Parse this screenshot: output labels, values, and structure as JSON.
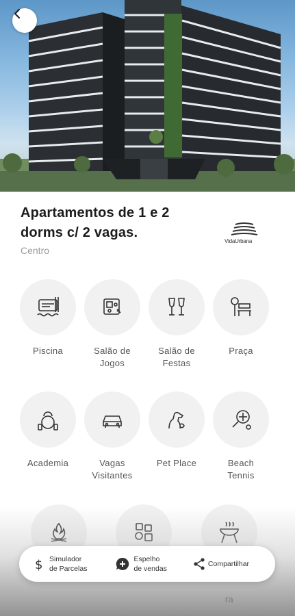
{
  "header": {
    "back_icon": "chevron-left-icon"
  },
  "property": {
    "title_line1": "Apartamentos de 1 e 2",
    "title_line2": "dorms c/ 2 vagas.",
    "location": "Centro",
    "brand_logo_text": "VidaUrbana"
  },
  "amenities": [
    {
      "label1": "Piscina",
      "label2": "",
      "icon": "pool-icon"
    },
    {
      "label1": "Salão de",
      "label2": "Jogos",
      "icon": "game-room-icon"
    },
    {
      "label1": "Salão de",
      "label2": "Festas",
      "icon": "party-glasses-icon"
    },
    {
      "label1": "Praça",
      "label2": "",
      "icon": "bench-icon"
    },
    {
      "label1": "Academia",
      "label2": "",
      "icon": "kettlebell-icon"
    },
    {
      "label1": "Vagas",
      "label2": "Visitantes",
      "icon": "car-icon"
    },
    {
      "label1": "Pet Place",
      "label2": "",
      "icon": "dog-icon"
    },
    {
      "label1": "Beach",
      "label2": "Tennis",
      "icon": "tennis-racket-icon"
    },
    {
      "label1": "",
      "label2": "",
      "icon": "fire-pit-icon"
    },
    {
      "label1": "",
      "label2": "",
      "icon": "games-icon"
    },
    {
      "label1": "",
      "label2": "ra",
      "icon": "barbecue-icon"
    }
  ],
  "bottom_bar": {
    "simulator_line1": "Simulador",
    "simulator_line2": "de Parcelas",
    "mirror_line1": "Espelho",
    "mirror_line2": "de vendas",
    "share": "Compartilhar"
  }
}
